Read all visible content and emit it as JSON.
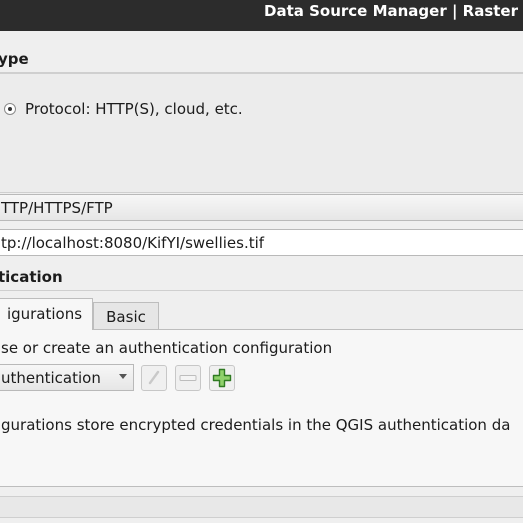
{
  "window": {
    "title": "Data Source Manager | Raster"
  },
  "source_type": {
    "section_label": "ype",
    "protocol_label": "Protocol: HTTP(S), cloud, etc.",
    "protocol_selected": true
  },
  "protocol": {
    "type_value": "TTP/HTTPS/FTP",
    "uri_value": "tp://localhost:8080/KifYI/swellies.tif"
  },
  "authentication": {
    "section_label": "tication",
    "tabs": [
      {
        "label": "igurations",
        "active": true
      },
      {
        "label": "Basic",
        "active": false
      }
    ],
    "instruction": "se or create an authentication configuration",
    "config_select_value": "uthentication",
    "note": "gurations store encrypted credentials in the QGIS authentication da",
    "buttons": {
      "edit_icon": "pencil-icon",
      "remove_icon": "minus-icon",
      "add_icon": "plus-icon"
    }
  }
}
